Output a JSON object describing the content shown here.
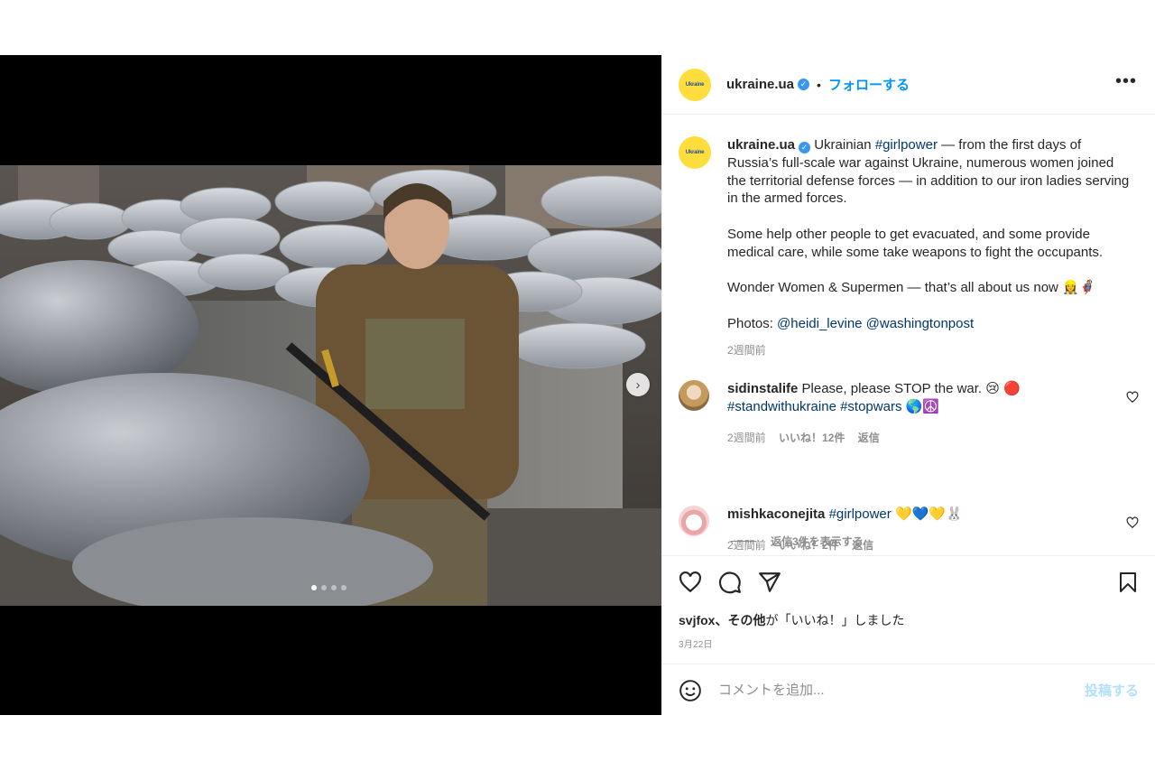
{
  "header": {
    "username": "ukraine.ua",
    "separator": "•",
    "follow_label": "フォローする",
    "more_label": "•••",
    "avatar_text": "Ukraine"
  },
  "caption": {
    "username": "ukraine.ua",
    "intro": "Ukrainian",
    "hashtag": "#girlpower",
    "para1_rest": "— from the first days of Russia’s full-scale war against Ukraine, numerous women joined the territorial defense forces — in addition to our iron ladies serving in the armed forces.",
    "para2": "Some help other people to get evacuated, and some provide medical care, while some take weapons to fight the occupants.",
    "para3": "Wonder Women & Supermen — that’s all about us now 👷‍♀️🦸",
    "photos_label": "Photos:",
    "mention1": "@heidi_levine",
    "mention2": "@washingtonpost",
    "time": "2週間前"
  },
  "comments": [
    {
      "username": "sidinstalife",
      "text": "Please, please STOP the war. 😢 🔴",
      "tags": "#standwithukraine #stopwars",
      "tags_emoji": "🌎☮️",
      "time": "2週間前",
      "likes": "いいね！12件",
      "reply": "返信",
      "view_replies": "返信3件を表示する"
    },
    {
      "username": "mishkaconejita",
      "tag": "#girlpower",
      "emoji": "💛💙💛🐰",
      "time": "2週間前",
      "likes": "いいね！2件",
      "reply": "返信"
    }
  ],
  "actions": {
    "liked_by_user": "svjfox",
    "liked_by_others": "、その他",
    "liked_suffix": "が「いいね！」しました",
    "date": "3月22日"
  },
  "add_comment": {
    "placeholder": "コメントを追加...",
    "post_label": "投稿する"
  },
  "carousel": {
    "next_icon": "chevron-right-icon",
    "total_slides": 4,
    "active_slide": 1
  },
  "colors": {
    "link_blue": "#0095f6",
    "hashtag": "#00376b",
    "verified": "#3897f0",
    "muted": "#8e8e8e",
    "avatar_bg": "#ffdd3c"
  }
}
